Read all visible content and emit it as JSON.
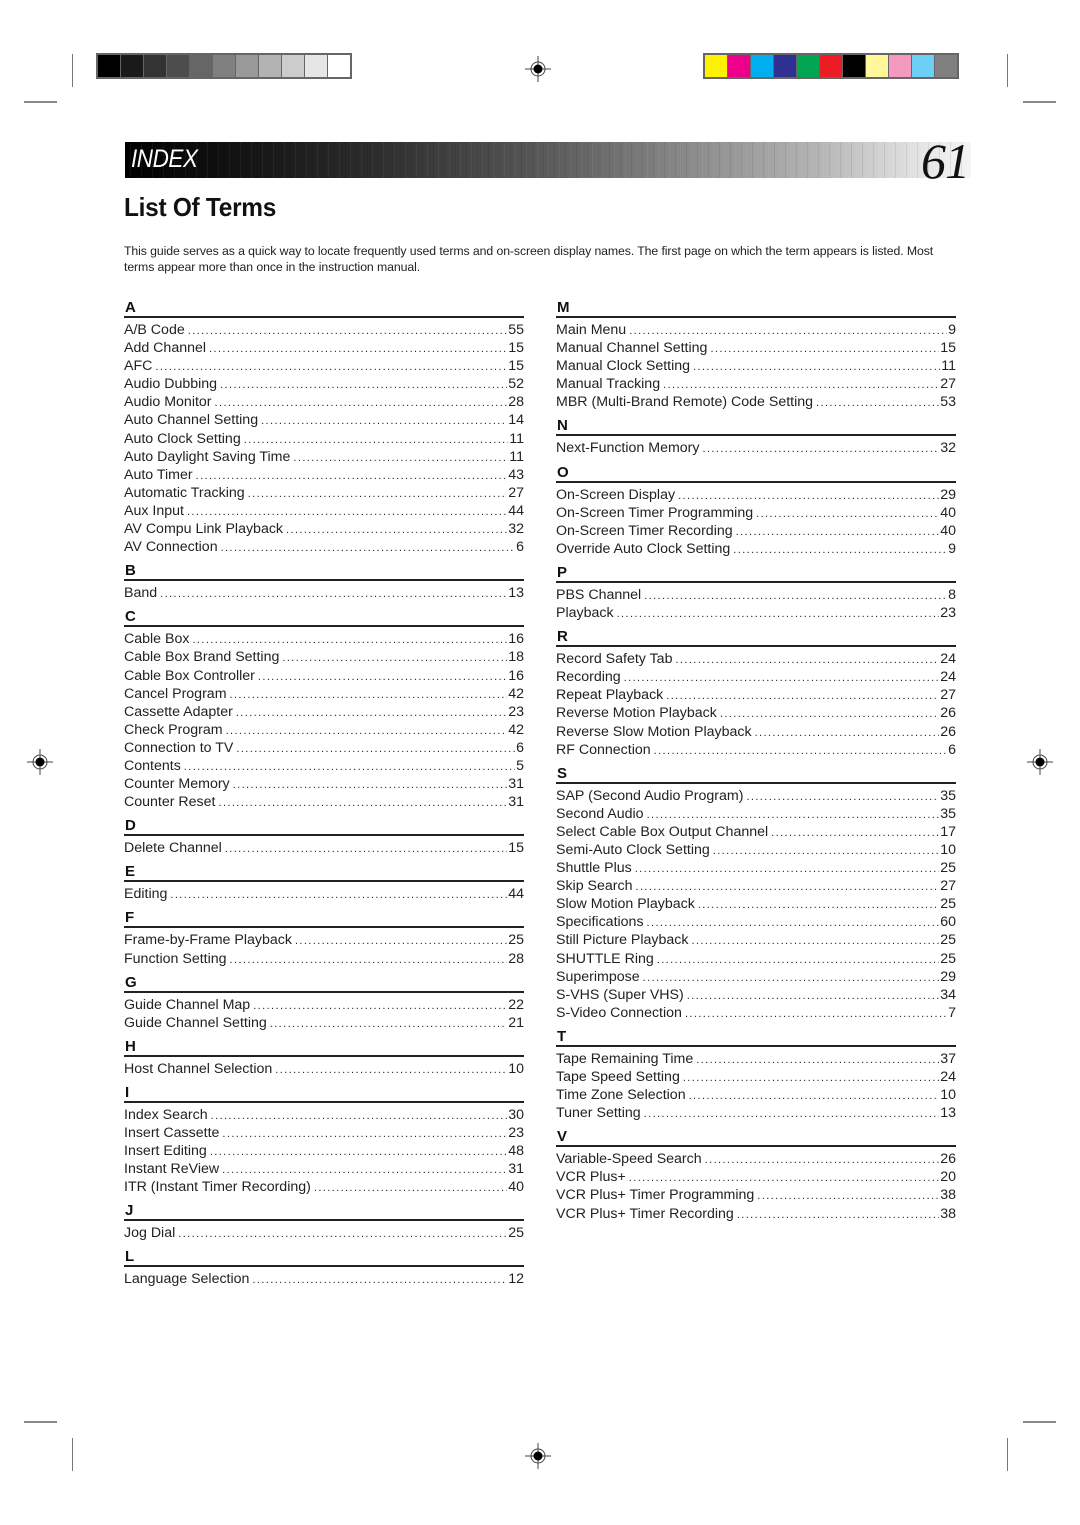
{
  "header": {
    "band_title": "INDEX",
    "page_number": "61"
  },
  "print_marks": {
    "grayscale_swatches": [
      "#000000",
      "#1a1a1a",
      "#333333",
      "#4d4d4d",
      "#666666",
      "#808080",
      "#999999",
      "#b3b3b3",
      "#cccccc",
      "#e6e6e6",
      "#ffffff"
    ],
    "color_swatches": [
      "#fff200",
      "#ec008c",
      "#00aeef",
      "#2e3192",
      "#00a651",
      "#ed1c24",
      "#000000",
      "#fff799",
      "#f49ac1",
      "#6dcff6",
      "#808080"
    ]
  },
  "title": "List Of Terms",
  "intro": "This guide serves as a quick way to locate frequently used terms and on-screen display names. The first page on which the term appears is listed. Most terms appear more than once in the instruction manual.",
  "left_column": [
    {
      "letter": "A",
      "entries": [
        {
          "term": "A/B Code",
          "page": "55"
        },
        {
          "term": "Add Channel",
          "page": "15"
        },
        {
          "term": "AFC",
          "page": "15"
        },
        {
          "term": "Audio Dubbing",
          "page": "52"
        },
        {
          "term": "Audio Monitor",
          "page": "28"
        },
        {
          "term": "Auto Channel Setting",
          "page": "14"
        },
        {
          "term": "Auto Clock Setting",
          "page": "11"
        },
        {
          "term": "Auto Daylight Saving Time",
          "page": "11"
        },
        {
          "term": "Auto Timer",
          "page": "43"
        },
        {
          "term": "Automatic Tracking",
          "page": "27"
        },
        {
          "term": "Aux Input",
          "page": "44"
        },
        {
          "term": "AV Compu Link Playback",
          "page": "32"
        },
        {
          "term": "AV Connection",
          "page": "6"
        }
      ]
    },
    {
      "letter": "B",
      "entries": [
        {
          "term": "Band",
          "page": "13"
        }
      ]
    },
    {
      "letter": "C",
      "entries": [
        {
          "term": "Cable Box",
          "page": "16"
        },
        {
          "term": "Cable Box Brand Setting",
          "page": "18"
        },
        {
          "term": "Cable Box Controller",
          "page": "16"
        },
        {
          "term": "Cancel Program",
          "page": "42"
        },
        {
          "term": "Cassette Adapter",
          "page": "23"
        },
        {
          "term": "Check Program",
          "page": "42"
        },
        {
          "term": "Connection to TV",
          "page": "6"
        },
        {
          "term": "Contents",
          "page": "5"
        },
        {
          "term": "Counter Memory",
          "page": "31"
        },
        {
          "term": "Counter Reset",
          "page": "31"
        }
      ]
    },
    {
      "letter": "D",
      "entries": [
        {
          "term": "Delete Channel",
          "page": "15"
        }
      ]
    },
    {
      "letter": "E",
      "entries": [
        {
          "term": "Editing",
          "page": "44"
        }
      ]
    },
    {
      "letter": "F",
      "entries": [
        {
          "term": "Frame-by-Frame Playback",
          "page": "25"
        },
        {
          "term": "Function Setting",
          "page": "28"
        }
      ]
    },
    {
      "letter": "G",
      "entries": [
        {
          "term": "Guide Channel Map",
          "page": "22"
        },
        {
          "term": "Guide Channel Setting",
          "page": "21"
        }
      ]
    },
    {
      "letter": "H",
      "entries": [
        {
          "term": "Host Channel Selection",
          "page": "10"
        }
      ]
    },
    {
      "letter": "I",
      "entries": [
        {
          "term": "Index Search",
          "page": "30"
        },
        {
          "term": "Insert Cassette",
          "page": "23"
        },
        {
          "term": "Insert Editing",
          "page": "48"
        },
        {
          "term": "Instant ReView",
          "page": "31"
        },
        {
          "term": "ITR (Instant Timer Recording)",
          "page": "40"
        }
      ]
    },
    {
      "letter": "J",
      "entries": [
        {
          "term": "Jog Dial",
          "page": "25"
        }
      ]
    },
    {
      "letter": "L",
      "entries": [
        {
          "term": "Language Selection",
          "page": "12"
        }
      ]
    }
  ],
  "right_column": [
    {
      "letter": "M",
      "entries": [
        {
          "term": "Main Menu",
          "page": "9"
        },
        {
          "term": "Manual Channel Setting",
          "page": "15"
        },
        {
          "term": "Manual Clock Setting",
          "page": "11"
        },
        {
          "term": "Manual Tracking",
          "page": "27"
        },
        {
          "term": "MBR (Multi-Brand Remote) Code Setting",
          "page": "53"
        }
      ]
    },
    {
      "letter": "N",
      "entries": [
        {
          "term": "Next-Function Memory",
          "page": "32"
        }
      ]
    },
    {
      "letter": "O",
      "entries": [
        {
          "term": "On-Screen Display",
          "page": "29"
        },
        {
          "term": "On-Screen Timer Programming",
          "page": "40"
        },
        {
          "term": "On-Screen Timer Recording",
          "page": "40"
        },
        {
          "term": "Override Auto Clock Setting",
          "page": "9"
        }
      ]
    },
    {
      "letter": "P",
      "entries": [
        {
          "term": "PBS Channel",
          "page": "8"
        },
        {
          "term": "Playback",
          "page": "23"
        }
      ]
    },
    {
      "letter": "R",
      "entries": [
        {
          "term": "Record Safety Tab",
          "page": "24"
        },
        {
          "term": "Recording",
          "page": "24"
        },
        {
          "term": "Repeat Playback",
          "page": "27"
        },
        {
          "term": "Reverse Motion Playback",
          "page": "26"
        },
        {
          "term": "Reverse Slow Motion Playback",
          "page": "26"
        },
        {
          "term": "RF Connection",
          "page": "6"
        }
      ]
    },
    {
      "letter": "S",
      "entries": [
        {
          "term": "SAP (Second Audio Program)",
          "page": "35"
        },
        {
          "term": "Second Audio",
          "page": "35"
        },
        {
          "term": "Select Cable Box Output Channel",
          "page": "17"
        },
        {
          "term": "Semi-Auto Clock Setting",
          "page": "10"
        },
        {
          "term": "Shuttle Plus",
          "page": "25"
        },
        {
          "term": "Skip Search",
          "page": "27"
        },
        {
          "term": "Slow Motion Playback",
          "page": "25"
        },
        {
          "term": "Specifications",
          "page": "60"
        },
        {
          "term": "Still Picture Playback",
          "page": "25"
        },
        {
          "term": "SHUTTLE Ring",
          "page": "25"
        },
        {
          "term": "Superimpose",
          "page": "29"
        },
        {
          "term": "S-VHS (Super VHS)",
          "page": "34"
        },
        {
          "term": "S-Video Connection",
          "page": "7"
        }
      ]
    },
    {
      "letter": "T",
      "entries": [
        {
          "term": "Tape Remaining Time",
          "page": "37"
        },
        {
          "term": "Tape Speed Setting",
          "page": "24"
        },
        {
          "term": "Time Zone Selection",
          "page": "10"
        },
        {
          "term": "Tuner Setting",
          "page": "13"
        }
      ]
    },
    {
      "letter": "V",
      "entries": [
        {
          "term": "Variable-Speed Search",
          "page": "26"
        },
        {
          "term": "VCR Plus+",
          "page": "20"
        },
        {
          "term": "VCR Plus+ Timer Programming",
          "page": "38"
        },
        {
          "term": "VCR Plus+ Timer Recording",
          "page": "38"
        }
      ]
    }
  ]
}
